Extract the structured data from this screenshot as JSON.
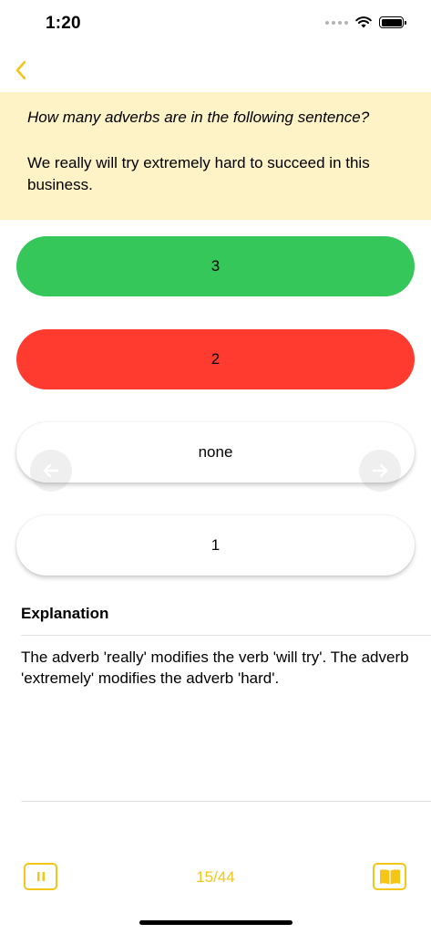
{
  "status_bar": {
    "time": "1:20"
  },
  "colors": {
    "accent": "#f5c518",
    "question_bg": "#fef2c7",
    "correct": "#36c75a",
    "wrong": "#ff3b30"
  },
  "question": {
    "prompt": "How many adverbs are in the following sentence?",
    "sentence": "We really will try extremely hard to succeed in this business."
  },
  "answers": [
    {
      "label": "3",
      "state": "correct"
    },
    {
      "label": "2",
      "state": "wrong"
    },
    {
      "label": "none",
      "state": "neutral"
    },
    {
      "label": "1",
      "state": "neutral"
    }
  ],
  "explanation": {
    "title": "Explanation",
    "text": "The adverb 'really' modifies the verb 'will try'. The adverb 'extremely' modifies the adverb 'hard'."
  },
  "toolbar": {
    "progress": "15/44",
    "icons": [
      "chevron-left-icon",
      "arrow-left-icon",
      "arrow-right-icon",
      "pause-icon",
      "book-icon"
    ]
  }
}
